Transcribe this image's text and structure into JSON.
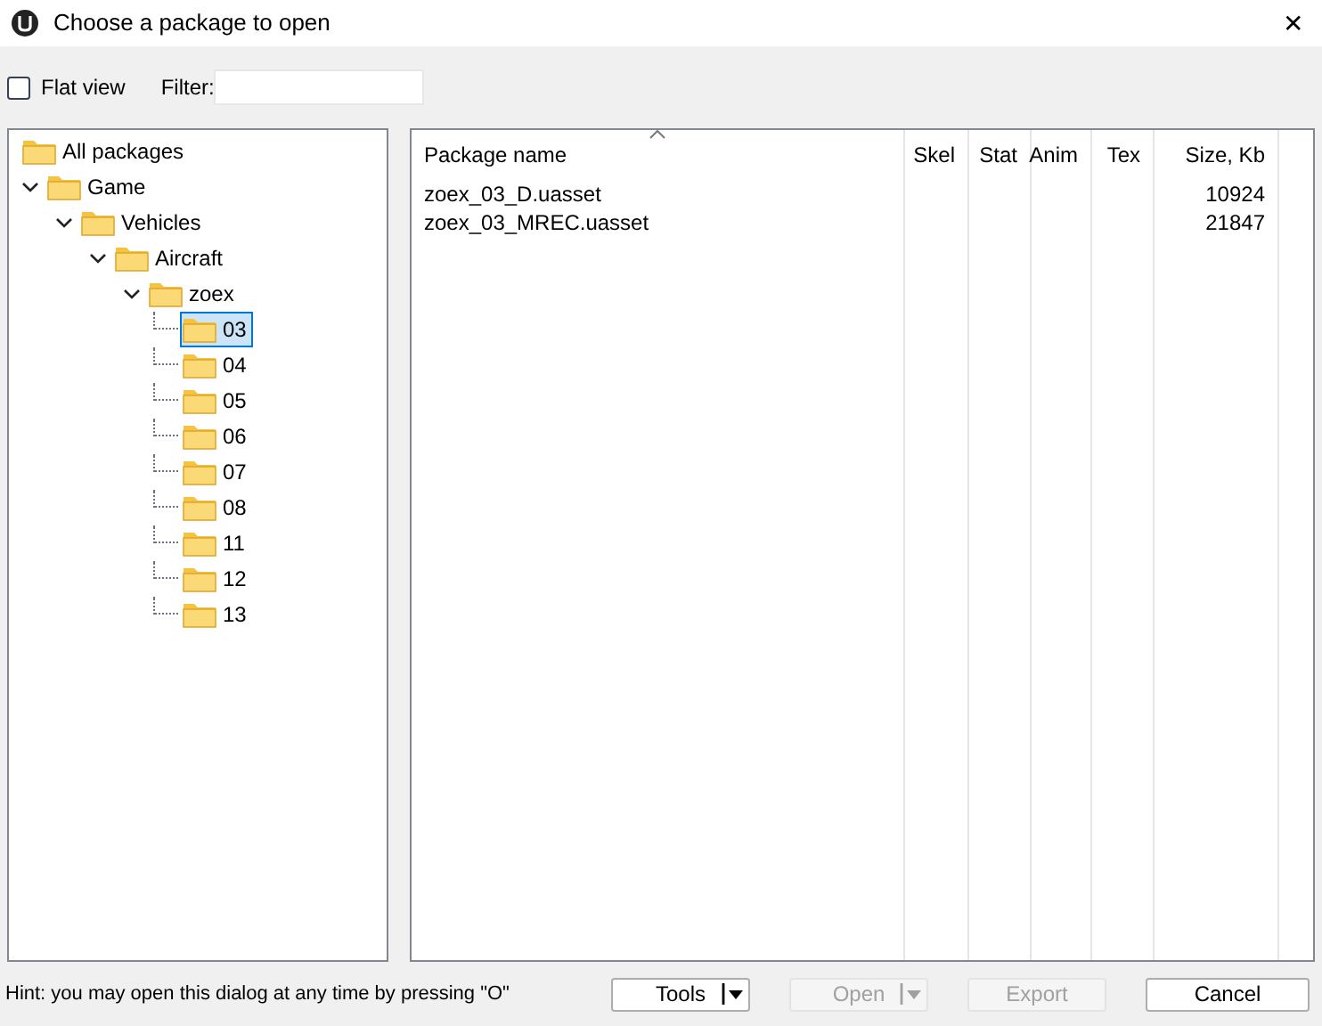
{
  "window": {
    "title": "Choose a package to open",
    "close": "✕"
  },
  "toolbar": {
    "flat_view": {
      "label": "Flat view",
      "checked": false
    },
    "filter": {
      "label": "Filter:"
    }
  },
  "tree": [
    {
      "label": "All packages",
      "selected": false,
      "children": [
        {
          "label": "Game",
          "expanded": true,
          "selected": false,
          "children": [
            {
              "label": "Vehicles",
              "expanded": true,
              "selected": false,
              "children": [
                {
                  "label": "Aircraft",
                  "expanded": true,
                  "selected": false,
                  "children": [
                    {
                      "label": "zoex",
                      "expanded": true,
                      "selected": false,
                      "children": [
                        {
                          "label": "03",
                          "selected": true
                        },
                        {
                          "label": "04",
                          "selected": false
                        },
                        {
                          "label": "05",
                          "selected": false
                        },
                        {
                          "label": "06",
                          "selected": false
                        },
                        {
                          "label": "07",
                          "selected": false
                        },
                        {
                          "label": "08",
                          "selected": false
                        },
                        {
                          "label": "11",
                          "selected": false
                        },
                        {
                          "label": "12",
                          "selected": false
                        },
                        {
                          "label": "13",
                          "selected": false
                        }
                      ]
                    }
                  ]
                }
              ]
            }
          ]
        }
      ]
    }
  ],
  "table": {
    "columns": [
      {
        "label": "Package name",
        "sorted": true
      },
      {
        "label": "Skel",
        "sorted": false
      },
      {
        "label": "Stat",
        "sorted": false
      },
      {
        "label": "Anim",
        "sorted": false
      },
      {
        "label": "Tex",
        "sorted": false
      },
      {
        "label": "Size, Kb",
        "sorted": false
      }
    ],
    "rows": [
      [
        "zoex_03_D.uasset",
        "",
        "",
        "",
        "",
        "10924"
      ],
      [
        "zoex_03_MREC.uasset",
        "",
        "",
        "",
        "",
        "21847"
      ]
    ]
  },
  "status_bar": {
    "hint": "Hint: you may open this dialog at any time by pressing \"O\""
  },
  "buttons": [
    {
      "label": "Tools",
      "disabled": false,
      "dropdown": true
    },
    {
      "label": "Open",
      "disabled": true,
      "dropdown": true
    },
    {
      "label": "Export",
      "disabled": true,
      "dropdown": false
    },
    {
      "label": "Cancel",
      "disabled": false,
      "dropdown": false
    }
  ]
}
